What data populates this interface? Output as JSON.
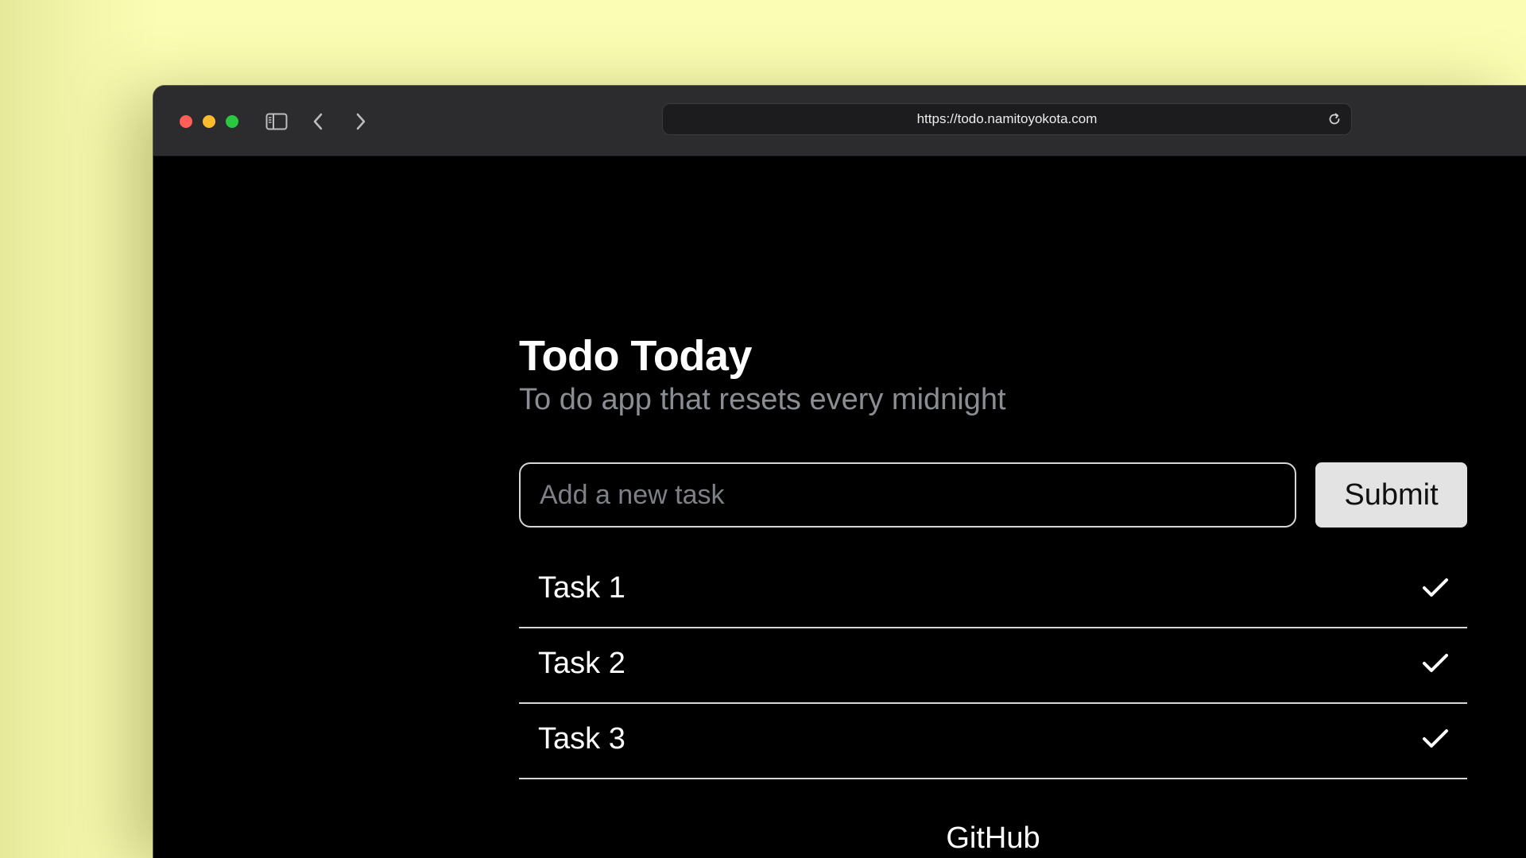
{
  "browser": {
    "url": "https://todo.namitoyokota.com",
    "icons": {
      "sidebar": "sidebar-icon",
      "back": "chevron-left-icon",
      "forward": "chevron-right-icon",
      "reload": "reload-icon"
    },
    "traffic_lights": [
      "#ff5f57",
      "#febc2e",
      "#28c840"
    ]
  },
  "app": {
    "title": "Todo Today",
    "subtitle": "To do app that resets every midnight",
    "input_placeholder": "Add a new task",
    "submit_label": "Submit",
    "tasks": [
      {
        "label": "Task 1",
        "icon": "check-icon"
      },
      {
        "label": "Task 2",
        "icon": "check-icon"
      },
      {
        "label": "Task 3",
        "icon": "check-icon"
      }
    ],
    "footer_link": "GitHub"
  },
  "colors": {
    "background": "#fbfdb4",
    "page_background": "#000000",
    "subtitle": "#8a8d92"
  }
}
